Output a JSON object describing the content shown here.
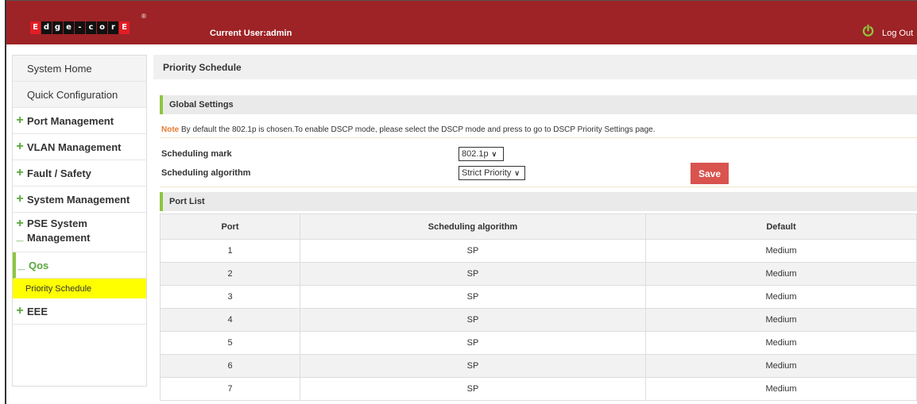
{
  "header": {
    "logo_letters": [
      "E",
      "d",
      "g",
      "e",
      "-",
      "c",
      "o",
      "r",
      "E"
    ],
    "logo_reg": "®",
    "current_user": "Current User:admin",
    "logout_label": "Log Out",
    "brand_color": "#9d2326"
  },
  "sidebar": {
    "items": [
      {
        "label": "System Home"
      },
      {
        "label": "Quick Configuration"
      },
      {
        "sign": "+",
        "label": "Port Management"
      },
      {
        "sign": "+",
        "label": "VLAN Management"
      },
      {
        "sign": "+",
        "label": "Fault / Safety"
      },
      {
        "sign": "+",
        "label": "System Management"
      },
      {
        "sign": "+",
        "sign2": "_",
        "label": "PSE System Management",
        "line1": "PSE System",
        "line2": "Management"
      },
      {
        "sign": "_",
        "label": "Qos"
      },
      {
        "sign": "+",
        "label": "EEE"
      }
    ],
    "active_sub": "Priority Schedule"
  },
  "main": {
    "title": "Priority Schedule",
    "global_settings": {
      "heading": "Global Settings",
      "note_label": "Note",
      "note_text": " By default the 802.1p is chosen.To enable DSCP mode, please select the DSCP mode and press to go to DSCP Priority Settings page.",
      "scheduling_mark_label": "Scheduling mark",
      "scheduling_mark_value": "802.1p",
      "scheduling_algorithm_label": "Scheduling algorithm",
      "scheduling_algorithm_value": "Strict Priority",
      "save_label": "Save"
    },
    "port_list": {
      "heading": "Port List",
      "columns": [
        "Port",
        "Scheduling algorithm",
        "Default"
      ],
      "rows": [
        [
          "1",
          "SP",
          "Medium"
        ],
        [
          "2",
          "SP",
          "Medium"
        ],
        [
          "3",
          "SP",
          "Medium"
        ],
        [
          "4",
          "SP",
          "Medium"
        ],
        [
          "5",
          "SP",
          "Medium"
        ],
        [
          "6",
          "SP",
          "Medium"
        ],
        [
          "7",
          "SP",
          "Medium"
        ]
      ]
    }
  },
  "colors": {
    "accent_green": "#8dc63f",
    "save_red": "#d9534f",
    "highlight_yellow": "#ffff00",
    "note_orange": "#e57b2f"
  }
}
